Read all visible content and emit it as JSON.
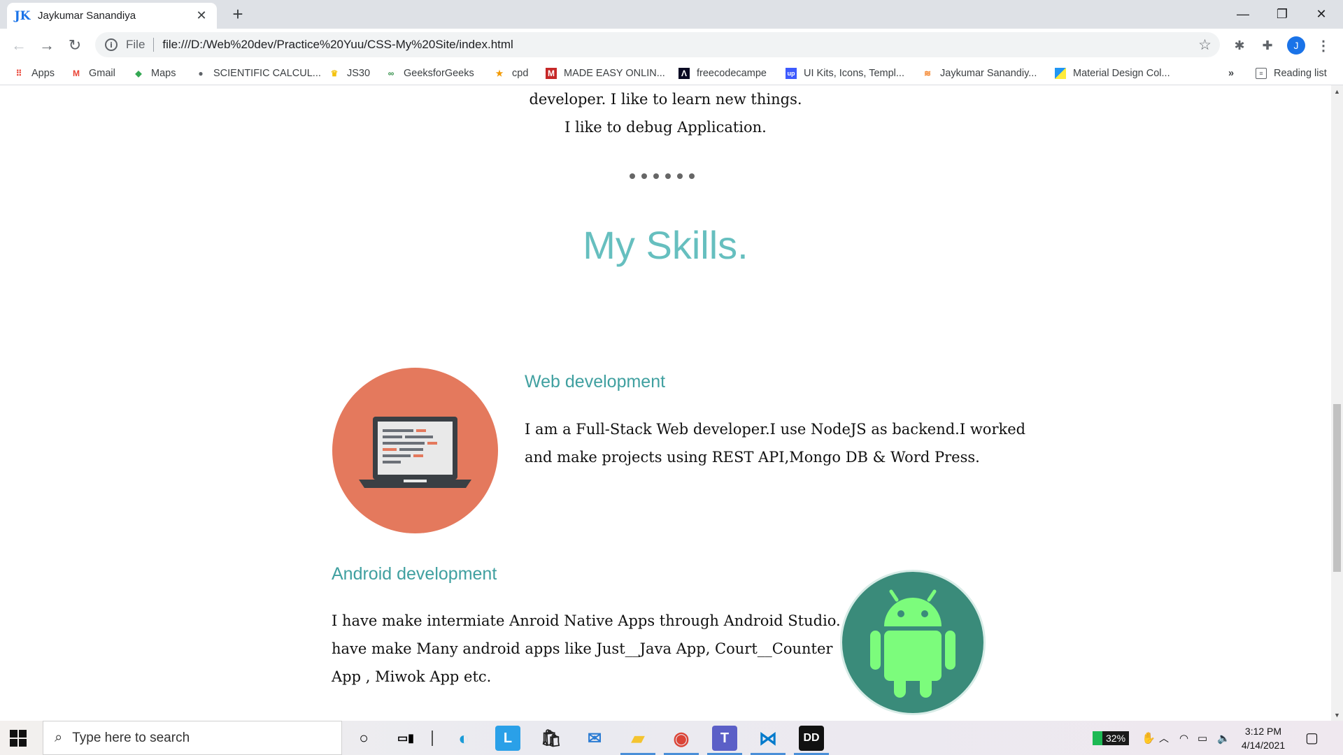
{
  "browser": {
    "tab_title": "Jaykumar Sanandiya",
    "tab_favicon": "JK",
    "url_scheme_label": "File",
    "url": "file:///D:/Web%20dev/Practice%20Yuu/CSS-My%20Site/index.html",
    "avatar_initial": "J",
    "bookmarks": [
      {
        "label": "Apps",
        "icon": "apps-grid-icon"
      },
      {
        "label": "Gmail",
        "icon": "gmail-icon"
      },
      {
        "label": "Maps",
        "icon": "maps-icon"
      },
      {
        "label": "SCIENTIFIC CALCUL...",
        "icon": "globe-icon"
      },
      {
        "label": "JS30",
        "icon": "crown-icon"
      },
      {
        "label": "GeeksforGeeks",
        "icon": "geeksforgeeks-icon"
      },
      {
        "label": "cpd",
        "icon": "star-icon"
      },
      {
        "label": "MADE EASY ONLIN...",
        "icon": "madeeasy-icon"
      },
      {
        "label": "freecodecampe",
        "icon": "freecodecamp-icon"
      },
      {
        "label": "UI Kits, Icons, Templ...",
        "icon": "uplabs-icon"
      },
      {
        "label": "Jaykumar Sanandiy...",
        "icon": "stackoverflow-icon"
      },
      {
        "label": "Material Design Col...",
        "icon": "material-icon"
      }
    ],
    "reading_list": "Reading list",
    "overflow": "»"
  },
  "page": {
    "intro_line1": "developer. I like to learn new things.",
    "intro_line2": "I like to debug Application.",
    "section_title": "My Skills.",
    "skills": [
      {
        "heading": "Web development",
        "text_line1": "I am a Full-Stack Web developer.I use NodeJS as backend.I worked",
        "text_line2": "and make projects using REST API,Mongo DB & Word Press.",
        "icon": "laptop-icon"
      },
      {
        "heading": "Android development",
        "text_line1": "I have make intermiate Anroid Native Apps through Android Studio. I",
        "text_line2": "have make Many android apps like Just__Java App, Court__Counter",
        "text_line3": "App , Miwok App etc.",
        "icon": "android-icon"
      }
    ],
    "colors": {
      "title": "#66BFBF",
      "heading": "#40A0A0",
      "web_circle": "#E4795D",
      "android_circle": "#3A8B7A",
      "android_robot": "#7CFC7C"
    }
  },
  "taskbar": {
    "search_placeholder": "Type here to search",
    "battery": "32%",
    "time": "3:12 PM",
    "date": "4/14/2021"
  }
}
